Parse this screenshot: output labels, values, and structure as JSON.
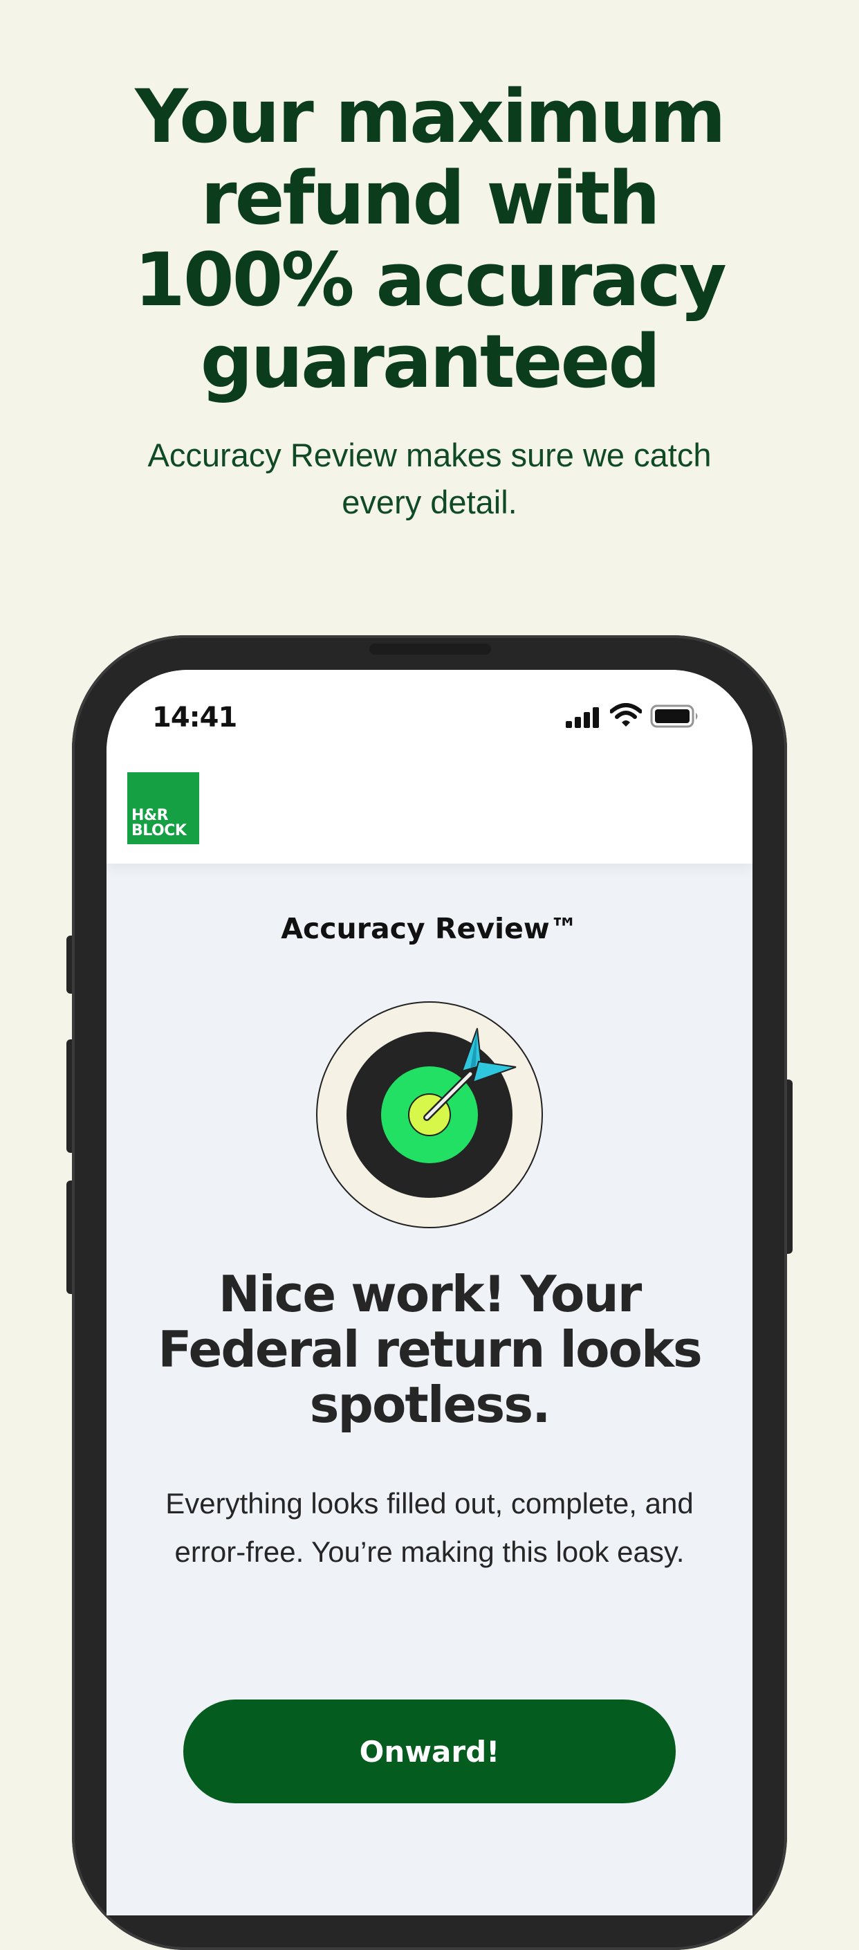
{
  "promo": {
    "headline": "Your maximum refund with 100% accuracy guaranteed",
    "subheadline": "Accuracy Review makes sure we catch every detail."
  },
  "status_bar": {
    "time": "14:41",
    "icons": [
      "signal-icon",
      "wifi-icon",
      "battery-icon"
    ]
  },
  "app": {
    "logo_line1": "H&R",
    "logo_line2": "BLOCK",
    "screen_title": "Accuracy Review™",
    "illustration_icon": "target-with-dart-icon",
    "heading": "Nice work! Your Federal return looks spotless.",
    "body": "Everything looks filled out, complete, and error-free. You’re making this look easy.",
    "primary_button": "Onward!"
  },
  "colors": {
    "background": "#f5f4e9",
    "headline_green": "#0b3d1c",
    "brand_green": "#14a043",
    "button_green": "#055c1f",
    "screen_background": "#eff3f8"
  }
}
